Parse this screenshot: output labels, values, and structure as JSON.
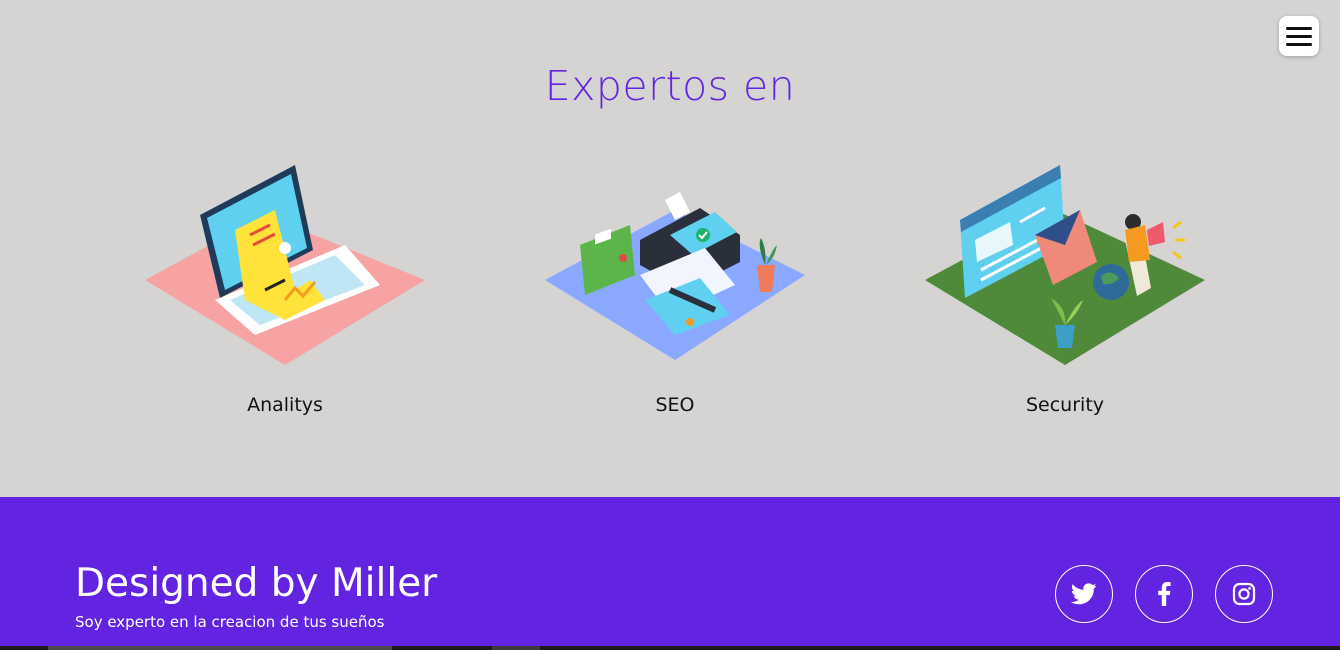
{
  "nav": {
    "menu_icon": "hamburger-menu-icon"
  },
  "section": {
    "title": "Expertos en",
    "cards": [
      {
        "label": "Analitys",
        "illustration": "analytics-laptop-illustration"
      },
      {
        "label": "SEO",
        "illustration": "payment-terminal-illustration"
      },
      {
        "label": "Security",
        "illustration": "email-marketing-illustration"
      }
    ]
  },
  "footer": {
    "title": "Designed by Miller",
    "subtitle": "Soy experto en la creacion de tus sueños",
    "social": [
      {
        "icon": "twitter-icon"
      },
      {
        "icon": "facebook-icon"
      },
      {
        "icon": "instagram-icon"
      }
    ]
  },
  "colors": {
    "accent": "#6224e0",
    "background": "#d5d4d3",
    "white": "#ffffff"
  }
}
